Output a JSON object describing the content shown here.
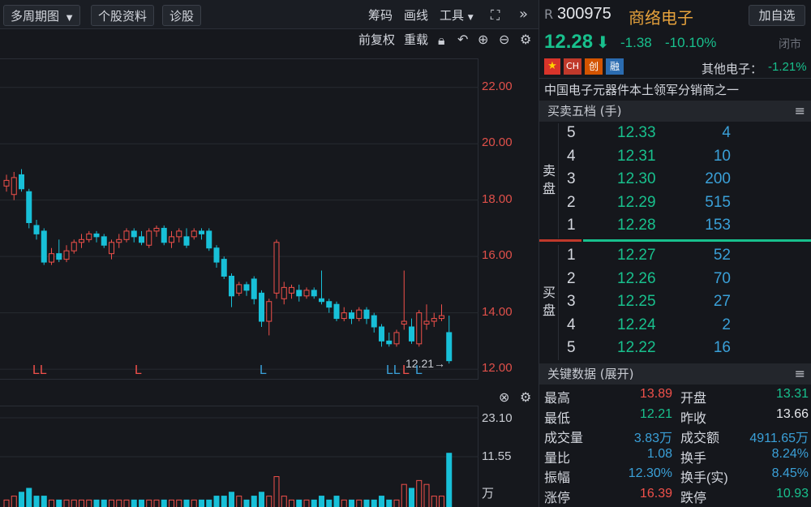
{
  "toolbar": {
    "period_button": "多周期图",
    "stock_info_button": "个股资料",
    "diagnose_button": "诊股",
    "chips": "筹码",
    "draw_line": "画线",
    "tools": "工具",
    "fq": "前复权",
    "reload": "重载"
  },
  "chart": {
    "y_ticks": [
      "22.00",
      "20.00",
      "18.00",
      "16.00",
      "14.00",
      "12.00"
    ],
    "low_marker": "12.21→",
    "l_markers": [
      {
        "text": "LL",
        "color": "#f0504a"
      },
      {
        "text": "L",
        "color": "#f0504a"
      },
      {
        "text": "L",
        "color": "#3aa0d8"
      },
      {
        "text": "LL",
        "color": "#3aa0d8"
      },
      {
        "text": "L",
        "color": "#f0504a"
      },
      {
        "text": "L",
        "color": "#3aa0d8"
      }
    ],
    "vol_ticks": [
      "23.10",
      "11.55",
      "万"
    ]
  },
  "chart_data": {
    "type": "candlestick",
    "ylim": [
      11.6,
      23.0
    ],
    "candles": [
      {
        "o": 18.5,
        "c": 18.7,
        "h": 18.9,
        "l": 18.3
      },
      {
        "o": 18.2,
        "c": 18.8,
        "h": 19.0,
        "l": 18.0
      },
      {
        "o": 18.9,
        "c": 18.4,
        "h": 19.1,
        "l": 18.3
      },
      {
        "o": 18.3,
        "c": 17.2,
        "h": 18.4,
        "l": 17.0
      },
      {
        "o": 17.1,
        "c": 16.8,
        "h": 17.3,
        "l": 16.6
      },
      {
        "o": 16.9,
        "c": 15.8,
        "h": 17.0,
        "l": 15.7
      },
      {
        "o": 15.8,
        "c": 16.1,
        "h": 16.3,
        "l": 15.7
      },
      {
        "o": 16.1,
        "c": 15.9,
        "h": 16.6,
        "l": 15.8
      },
      {
        "o": 15.9,
        "c": 16.2,
        "h": 16.4,
        "l": 15.8
      },
      {
        "o": 16.2,
        "c": 16.5,
        "h": 16.6,
        "l": 16.1
      },
      {
        "o": 16.5,
        "c": 16.6,
        "h": 16.8,
        "l": 16.3
      },
      {
        "o": 16.6,
        "c": 16.8,
        "h": 16.9,
        "l": 16.5
      },
      {
        "o": 16.8,
        "c": 16.7,
        "h": 16.9,
        "l": 16.5
      },
      {
        "o": 16.7,
        "c": 16.4,
        "h": 16.8,
        "l": 16.3
      },
      {
        "o": 16.1,
        "c": 16.5,
        "h": 16.6,
        "l": 15.9
      },
      {
        "o": 16.5,
        "c": 16.6,
        "h": 16.8,
        "l": 16.3
      },
      {
        "o": 16.6,
        "c": 16.9,
        "h": 17.0,
        "l": 16.5
      },
      {
        "o": 16.9,
        "c": 16.7,
        "h": 17.0,
        "l": 16.5
      },
      {
        "o": 16.7,
        "c": 16.5,
        "h": 16.9,
        "l": 16.4
      },
      {
        "o": 16.4,
        "c": 16.9,
        "h": 17.0,
        "l": 16.3
      },
      {
        "o": 16.9,
        "c": 17.0,
        "h": 17.1,
        "l": 16.7
      },
      {
        "o": 17.0,
        "c": 16.5,
        "h": 17.1,
        "l": 16.4
      },
      {
        "o": 16.5,
        "c": 16.7,
        "h": 16.9,
        "l": 16.3
      },
      {
        "o": 16.7,
        "c": 16.9,
        "h": 17.0,
        "l": 16.5
      },
      {
        "o": 16.7,
        "c": 16.4,
        "h": 17.0,
        "l": 16.3
      },
      {
        "o": 16.7,
        "c": 16.9,
        "h": 17.0,
        "l": 16.6
      },
      {
        "o": 16.9,
        "c": 16.8,
        "h": 17.0,
        "l": 16.6
      },
      {
        "o": 16.9,
        "c": 16.3,
        "h": 17.0,
        "l": 16.2
      },
      {
        "o": 16.3,
        "c": 15.8,
        "h": 16.4,
        "l": 15.6
      },
      {
        "o": 15.9,
        "c": 15.3,
        "h": 16.0,
        "l": 15.2
      },
      {
        "o": 15.3,
        "c": 14.6,
        "h": 15.4,
        "l": 14.2
      },
      {
        "o": 14.7,
        "c": 15.0,
        "h": 15.1,
        "l": 14.6
      },
      {
        "o": 15.0,
        "c": 14.8,
        "h": 15.1,
        "l": 14.6
      },
      {
        "o": 15.2,
        "c": 14.5,
        "h": 15.3,
        "l": 14.3
      },
      {
        "o": 14.7,
        "c": 13.7,
        "h": 14.8,
        "l": 13.5
      },
      {
        "o": 13.7,
        "c": 14.4,
        "h": 14.5,
        "l": 13.2
      },
      {
        "o": 14.7,
        "c": 16.5,
        "h": 16.6,
        "l": 14.5
      },
      {
        "o": 14.5,
        "c": 14.9,
        "h": 15.1,
        "l": 14.3
      },
      {
        "o": 14.7,
        "c": 14.9,
        "h": 15.0,
        "l": 14.5
      },
      {
        "o": 14.8,
        "c": 14.6,
        "h": 15.0,
        "l": 14.4
      },
      {
        "o": 14.6,
        "c": 14.8,
        "h": 14.9,
        "l": 14.5
      },
      {
        "o": 14.8,
        "c": 14.6,
        "h": 14.9,
        "l": 14.5
      },
      {
        "o": 14.5,
        "c": 14.4,
        "h": 15.5,
        "l": 14.3
      },
      {
        "o": 14.4,
        "c": 14.2,
        "h": 14.5,
        "l": 14.0
      },
      {
        "o": 14.3,
        "c": 13.8,
        "h": 14.4,
        "l": 13.7
      },
      {
        "o": 13.8,
        "c": 14.0,
        "h": 14.2,
        "l": 13.7
      },
      {
        "o": 14.0,
        "c": 13.8,
        "h": 14.1,
        "l": 13.6
      },
      {
        "o": 13.8,
        "c": 14.1,
        "h": 14.2,
        "l": 13.7
      },
      {
        "o": 14.1,
        "c": 13.8,
        "h": 14.2,
        "l": 13.6
      },
      {
        "o": 13.9,
        "c": 13.5,
        "h": 14.0,
        "l": 13.3
      },
      {
        "o": 13.5,
        "c": 13.0,
        "h": 13.6,
        "l": 12.8
      },
      {
        "o": 13.0,
        "c": 12.9,
        "h": 13.3,
        "l": 12.8
      },
      {
        "o": 12.9,
        "c": 13.3,
        "h": 13.4,
        "l": 12.8
      },
      {
        "o": 13.6,
        "c": 13.7,
        "h": 15.5,
        "l": 13.4
      },
      {
        "o": 13.5,
        "c": 13.0,
        "h": 13.8,
        "l": 12.9
      },
      {
        "o": 12.9,
        "c": 14.0,
        "h": 14.1,
        "l": 12.8
      },
      {
        "o": 13.6,
        "c": 13.7,
        "h": 14.3,
        "l": 13.4
      },
      {
        "o": 13.7,
        "c": 13.8,
        "h": 14.0,
        "l": 13.5
      },
      {
        "o": 13.8,
        "c": 13.9,
        "h": 14.3,
        "l": 13.7
      },
      {
        "o": 13.3,
        "c": 12.3,
        "h": 13.9,
        "l": 12.2
      }
    ],
    "volume": [
      2,
      3,
      4,
      5,
      3,
      3,
      2,
      2,
      2,
      2,
      2,
      2,
      2,
      2,
      2,
      2,
      2,
      2,
      2,
      2,
      2,
      2,
      2,
      2,
      2,
      2,
      2,
      2,
      3,
      3,
      4,
      3,
      2,
      3,
      4,
      3,
      8,
      3,
      2,
      2,
      2,
      2,
      3,
      2,
      3,
      2,
      2,
      2,
      2,
      2,
      3,
      2,
      2,
      6,
      5,
      7,
      6,
      3,
      3,
      14
    ],
    "vol_max": 23.1
  },
  "quote": {
    "badge": "R",
    "code": "300975",
    "name": "商络电子",
    "add_button": "加自选",
    "price": "12.28",
    "change": "-1.38",
    "change_pct": "-10.10%",
    "market_status": "闭市",
    "tags": [
      "CH",
      "创",
      "融"
    ],
    "sector": "其他电子：",
    "sector_pct": "-1.21%",
    "description": "中国电子元器件本土领军分销商之一"
  },
  "orderbook": {
    "title": "买卖五档 (手)",
    "sell_label": "卖盘",
    "buy_label": "买盘",
    "sell": [
      {
        "level": "5",
        "price": "12.33",
        "vol": "4"
      },
      {
        "level": "4",
        "price": "12.31",
        "vol": "10"
      },
      {
        "level": "3",
        "price": "12.30",
        "vol": "200"
      },
      {
        "level": "2",
        "price": "12.29",
        "vol": "515"
      },
      {
        "level": "1",
        "price": "12.28",
        "vol": "153"
      }
    ],
    "buy": [
      {
        "level": "1",
        "price": "12.27",
        "vol": "52"
      },
      {
        "level": "2",
        "price": "12.26",
        "vol": "70"
      },
      {
        "level": "3",
        "price": "12.25",
        "vol": "27"
      },
      {
        "level": "4",
        "price": "12.24",
        "vol": "2"
      },
      {
        "level": "5",
        "price": "12.22",
        "vol": "16"
      }
    ]
  },
  "keydata": {
    "title": "关键数据 (展开)",
    "rows": [
      {
        "l1": "最高",
        "v1": "13.89",
        "c1": "red",
        "l2": "开盘",
        "v2": "13.31",
        "c2": "green"
      },
      {
        "l1": "最低",
        "v1": "12.21",
        "c1": "green",
        "l2": "昨收",
        "v2": "13.66",
        "c2": "white"
      },
      {
        "l1": "成交量",
        "v1": "3.83万",
        "c1": "blue",
        "l2": "成交额",
        "v2": "4911.65万",
        "c2": "blue"
      },
      {
        "l1": "量比",
        "v1": "1.08",
        "c1": "blue",
        "l2": "换手",
        "v2": "8.24%",
        "c2": "blue"
      },
      {
        "l1": "振幅",
        "v1": "12.30%",
        "c1": "blue",
        "l2": "换手(实)",
        "v2": "8.45%",
        "c2": "blue"
      },
      {
        "l1": "涨停",
        "v1": "16.39",
        "c1": "red",
        "l2": "跌停",
        "v2": "10.93",
        "c2": "green"
      }
    ]
  },
  "colors": {
    "up": "#f0504a",
    "down": "#18c0d8",
    "bg": "#16181d"
  }
}
